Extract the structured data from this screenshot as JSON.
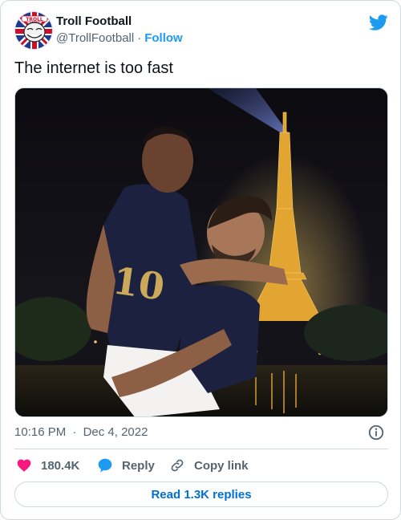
{
  "author": {
    "name": "Troll Football",
    "handle": "@TrollFootball",
    "separator": "·",
    "follow_label": "Follow",
    "avatar_icon": "troll-face-avatar",
    "logo_icon": "twitter-bird-icon",
    "brand_color": "#1d9bf0"
  },
  "tweet": {
    "text": "The internet is too fast",
    "media_description": "photo",
    "time": "10:16 PM",
    "separator": "·",
    "date": "Dec 4, 2022"
  },
  "actions": {
    "likes": "180.4K",
    "reply_label": "Reply",
    "copy_label": "Copy link",
    "like_color": "#f91880",
    "reply_color": "#1d9bf0"
  },
  "read_replies_label": "Read 1.3K replies"
}
